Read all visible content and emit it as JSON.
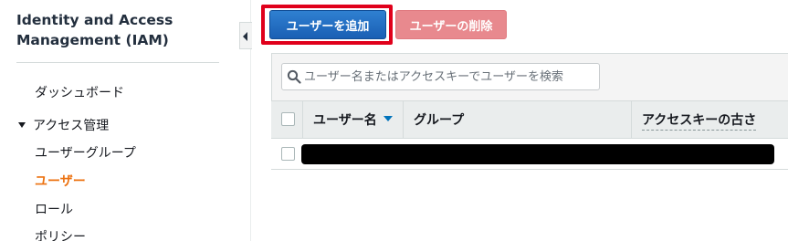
{
  "sidebar": {
    "title": "Identity and Access Management (IAM)",
    "dashboard": "ダッシュボード",
    "access_management": "アクセス管理",
    "items": [
      {
        "label": "ユーザーグループ",
        "active": false
      },
      {
        "label": "ユーザー",
        "active": true
      },
      {
        "label": "ロール",
        "active": false
      },
      {
        "label": "ポリシー",
        "active": false
      }
    ]
  },
  "toolbar": {
    "add_user_label": "ユーザーを追加",
    "delete_user_label": "ユーザーの削除"
  },
  "search": {
    "placeholder": "ユーザー名またはアクセスキーでユーザーを検索"
  },
  "table": {
    "columns": [
      "ユーザー名",
      "グループ",
      "アクセスキーの古さ"
    ],
    "sorted_column": "ユーザー名",
    "sort_direction": "descending",
    "rows": [
      {
        "redacted": true
      }
    ]
  },
  "colors": {
    "primary_button": "#1a5fb4",
    "danger_disabled": "#e8898e",
    "highlight": "#e0001b",
    "active_nav": "#ec7211",
    "sort_icon": "#0073bb"
  },
  "icons": [
    "search-icon",
    "collapse-icon",
    "sort-desc-icon",
    "expand-caret-icon"
  ]
}
